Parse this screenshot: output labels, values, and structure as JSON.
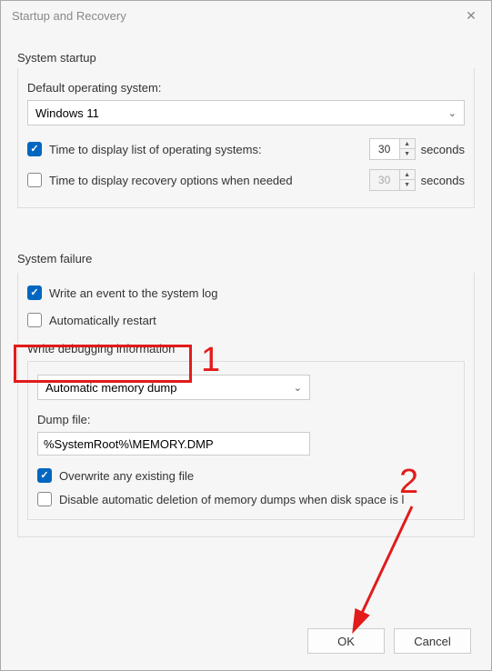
{
  "title": "Startup and Recovery",
  "startup": {
    "section_label": "System startup",
    "default_os_label": "Default operating system:",
    "default_os_value": "Windows 11",
    "display_list": {
      "label": "Time to display list of operating systems:",
      "checked": true,
      "value": "30",
      "unit": "seconds"
    },
    "display_recovery": {
      "label": "Time to display recovery options when needed",
      "checked": false,
      "value": "30",
      "unit": "seconds"
    }
  },
  "failure": {
    "section_label": "System failure",
    "write_event": {
      "label": "Write an event to the system log",
      "checked": true
    },
    "auto_restart": {
      "label": "Automatically restart",
      "checked": false
    },
    "debug_label": "Write debugging information",
    "debug_select": "Automatic memory dump",
    "dump_label": "Dump file:",
    "dump_value": "%SystemRoot%\\MEMORY.DMP",
    "overwrite": {
      "label": "Overwrite any existing file",
      "checked": true
    },
    "disable_auto_del": {
      "label": "Disable automatic deletion of memory dumps when disk space is l",
      "checked": false
    }
  },
  "buttons": {
    "ok": "OK",
    "cancel": "Cancel"
  },
  "annotations": {
    "one": "1",
    "two": "2"
  }
}
